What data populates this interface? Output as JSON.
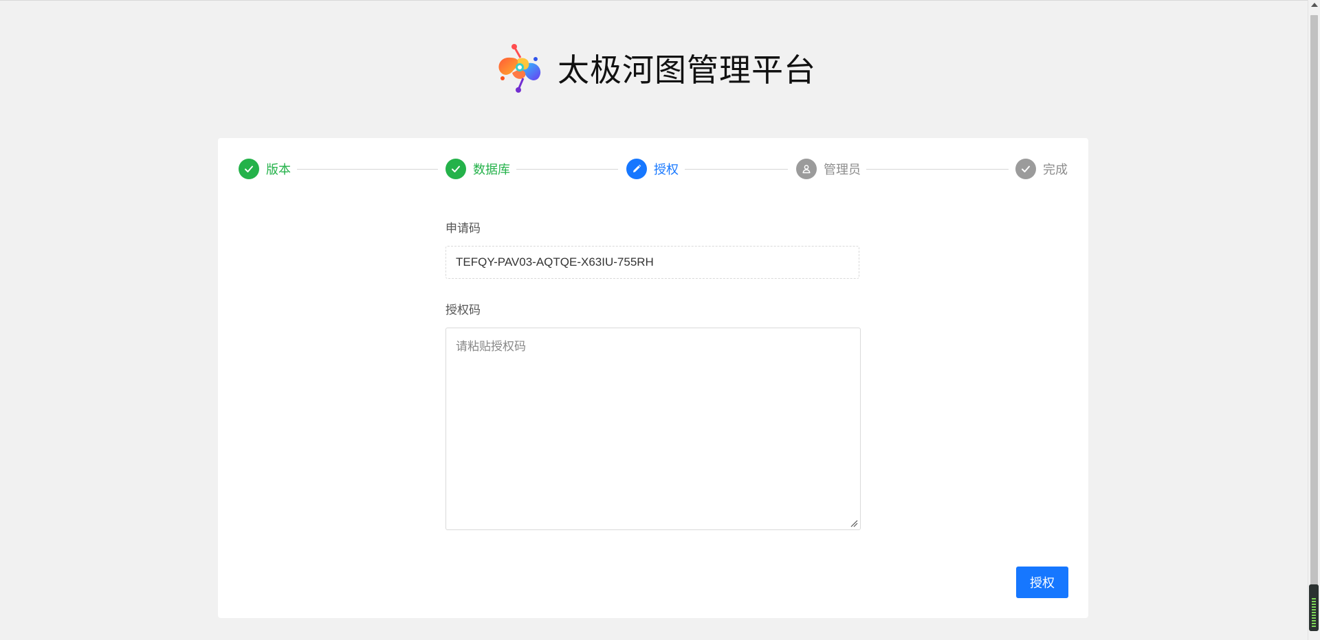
{
  "app": {
    "title": "太极河图管理平台",
    "logo_icon": "molecule-logo-icon"
  },
  "steps": [
    {
      "label": "版本",
      "status": "done",
      "icon": "check-icon"
    },
    {
      "label": "数据库",
      "status": "done",
      "icon": "check-icon"
    },
    {
      "label": "授权",
      "status": "active",
      "icon": "pencil-icon"
    },
    {
      "label": "管理员",
      "status": "wait",
      "icon": "user-icon"
    },
    {
      "label": "完成",
      "status": "wait",
      "icon": "check-icon"
    }
  ],
  "form": {
    "apply_code": {
      "label": "申请码",
      "value": "TEFQY-PAV03-AQTQE-X63IU-755RH"
    },
    "auth_code": {
      "label": "授权码",
      "placeholder": "请粘贴授权码",
      "value": ""
    }
  },
  "actions": {
    "submit_label": "授权"
  },
  "colors": {
    "done": "#24b24a",
    "active": "#1677ff",
    "wait": "#9b9b9b",
    "background": "#f1f1f1",
    "card": "#ffffff"
  }
}
